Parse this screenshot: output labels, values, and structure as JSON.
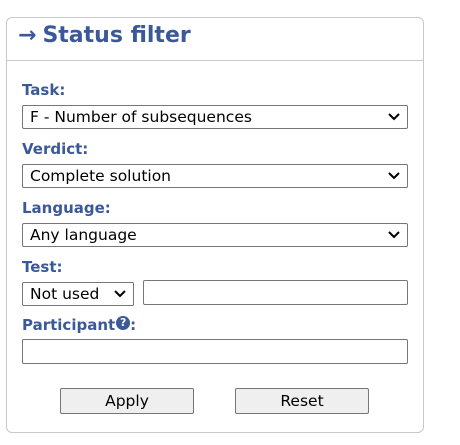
{
  "panel": {
    "arrow": "→",
    "title": "Status filter"
  },
  "task": {
    "label": "Task:",
    "selected": "F - Number of subsequences"
  },
  "verdict": {
    "label": "Verdict:",
    "selected": "Complete solution"
  },
  "language": {
    "label": "Language:",
    "selected": "Any language"
  },
  "test": {
    "label": "Test:",
    "mode_selected": "Not used",
    "value": ""
  },
  "participant": {
    "label": "Participant",
    "help_glyph": "?",
    "colon": ":",
    "value": ""
  },
  "buttons": {
    "apply": "Apply",
    "reset": "Reset"
  },
  "colors": {
    "accent": "#3b5998",
    "border": "#c8c8c8",
    "button_bg": "#efefef"
  },
  "icons": {
    "dropdown": "chevron-down-icon",
    "help": "question-circle-icon"
  }
}
